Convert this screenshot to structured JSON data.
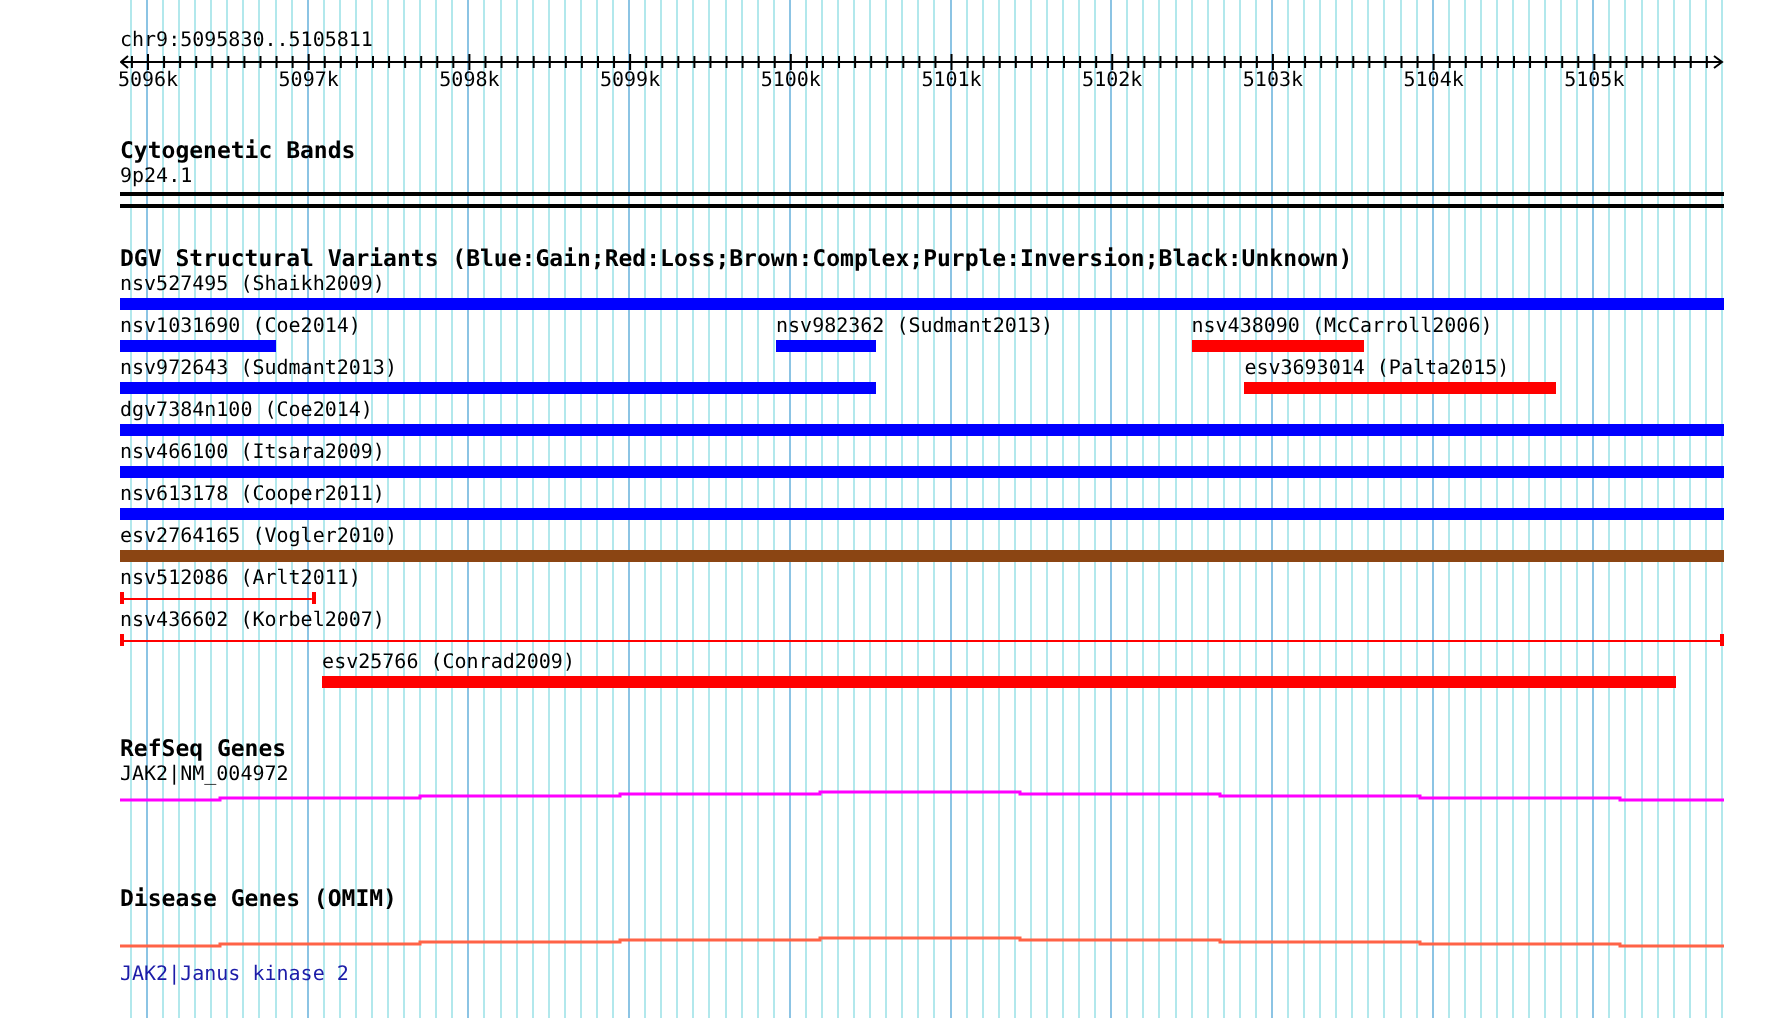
{
  "ruler": {
    "range": "chr9:5095830..5105811",
    "tick_labels": [
      "5096k",
      "5097k",
      "5098k",
      "5099k",
      "5100k",
      "5101k",
      "5102k",
      "5103k",
      "5104k",
      "5105k"
    ]
  },
  "tracks": [
    {
      "kind": "cytoband",
      "title": "Cytogenetic Bands",
      "label": "9p24.1"
    },
    {
      "kind": "variants",
      "title": "DGV Structural Variants (Blue:Gain;Red:Loss;Brown:Complex;Purple:Inversion;Black:Unknown)",
      "rows": [
        {
          "features": [
            {
              "label": "nsv527495 (Shaikh2009)",
              "kind": "bar",
              "color": "#0000ff"
            }
          ]
        },
        {
          "features": [
            {
              "label": "nsv1031690 (Coe2014)",
              "kind": "bar",
              "color": "#0000ff"
            },
            {
              "label": "nsv982362 (Sudmant2013)",
              "kind": "bar",
              "color": "#0000ff"
            },
            {
              "label": "nsv438090 (McCarroll2006)",
              "kind": "bar",
              "color": "#ff0000"
            }
          ]
        },
        {
          "features": [
            {
              "label": "nsv972643 (Sudmant2013)",
              "kind": "bar",
              "color": "#0000ff"
            },
            {
              "label": "esv3693014 (Palta2015)",
              "kind": "bar",
              "color": "#ff0000"
            }
          ]
        },
        {
          "features": [
            {
              "label": "dgv7384n100 (Coe2014)",
              "kind": "bar",
              "color": "#0000ff"
            }
          ]
        },
        {
          "features": [
            {
              "label": "nsv466100 (Itsara2009)",
              "kind": "bar",
              "color": "#0000ff"
            }
          ]
        },
        {
          "features": [
            {
              "label": "nsv613178 (Cooper2011)",
              "kind": "bar",
              "color": "#0000ff"
            }
          ]
        },
        {
          "features": [
            {
              "label": "esv2764165 (Vogler2010)",
              "kind": "bar",
              "color": "#8b4513"
            }
          ]
        },
        {
          "features": [
            {
              "label": "nsv512086 (Arlt2011)",
              "kind": "line",
              "color": "#ff0000"
            }
          ]
        },
        {
          "features": [
            {
              "label": "nsv436602 (Korbel2007)",
              "kind": "line",
              "color": "#ff0000"
            }
          ]
        },
        {
          "features": [
            {
              "label": "esv25766 (Conrad2009)",
              "kind": "bar",
              "color": "#ff0000"
            }
          ]
        }
      ]
    },
    {
      "kind": "gene",
      "title": "RefSeq Genes",
      "label": "JAK2|NM_004972",
      "color": "#ff00ff"
    },
    {
      "kind": "disease",
      "title": "Disease Genes (OMIM)",
      "label": "JAK2|Janus kinase 2",
      "color": "#ff6347"
    }
  ]
}
